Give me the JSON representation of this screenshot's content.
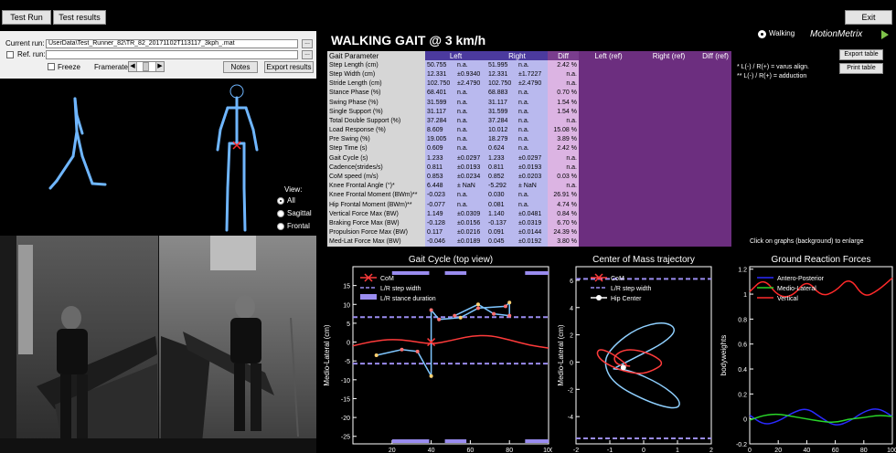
{
  "toolbar": {
    "test_run_tab": "Test Run",
    "test_results_tab": "Test results",
    "exit_button": "Exit"
  },
  "left": {
    "current_run_label": "Current run:",
    "current_run_value": "UserData\\Test_Runner_82\\TR_82_20171102T113117_3kph_.mat",
    "browse_button": "...",
    "ref_run_label": "Ref. run:",
    "ref_run_value": "",
    "freeze_label": "Freeze",
    "framerate_label": "Framerate",
    "notes_button": "Notes",
    "export_results_button": "Export results",
    "view_label": "View:",
    "view_options": [
      "All",
      "Sagittal",
      "Frontal"
    ],
    "view_selected": "All"
  },
  "header": {
    "title": "WALKING GAIT @ 3  km/h",
    "mode_label": "Walking",
    "brand": "MotionMetrix"
  },
  "table": {
    "columns": [
      "Gait Parameter",
      "Left",
      "Right",
      "Diff",
      "Left (ref)",
      "Right (ref)",
      "Diff (ref)"
    ],
    "rows": [
      {
        "name": "Step Length (cm)",
        "left": "50.755",
        "left_sd": "n.a.",
        "right": "51.995",
        "right_sd": "n.a.",
        "diff": "2.42 %"
      },
      {
        "name": "Step Width (cm)",
        "left": "12.331",
        "left_sd": "±0.9340",
        "right": "12.331",
        "right_sd": "±1.7227",
        "diff": "n.a."
      },
      {
        "name": "Stride Length (cm)",
        "left": "102.750",
        "left_sd": "±2.4790",
        "right": "102.750",
        "right_sd": "±2.4790",
        "diff": "n.a."
      },
      {
        "name": "Stance Phase (%)",
        "left": "68.401",
        "left_sd": "n.a.",
        "right": "68.883",
        "right_sd": "n.a.",
        "diff": "0.70 %"
      },
      {
        "name": "Swing Phase (%)",
        "left": "31.599",
        "left_sd": "n.a.",
        "right": "31.117",
        "right_sd": "n.a.",
        "diff": "1.54 %"
      },
      {
        "name": "Single Support (%)",
        "left": "31.117",
        "left_sd": "n.a.",
        "right": "31.599",
        "right_sd": "n.a.",
        "diff": "1.54 %"
      },
      {
        "name": "Total Double Support (%)",
        "left": "37.284",
        "left_sd": "n.a.",
        "right": "37.284",
        "right_sd": "n.a.",
        "diff": "n.a."
      },
      {
        "name": "Load Response (%)",
        "left": "8.609",
        "left_sd": "n.a.",
        "right": "10.012",
        "right_sd": "n.a.",
        "diff": "15.08 %"
      },
      {
        "name": "Pre Swing (%)",
        "left": "19.005",
        "left_sd": "n.a.",
        "right": "18.279",
        "right_sd": "n.a.",
        "diff": "3.89 %"
      },
      {
        "name": "Step Time (s)",
        "left": "0.609",
        "left_sd": "n.a.",
        "right": "0.624",
        "right_sd": "n.a.",
        "diff": "2.42 %"
      },
      {
        "name": "Gait Cycle (s)",
        "left": "1.233",
        "left_sd": "±0.0297",
        "right": "1.233",
        "right_sd": "±0.0297",
        "diff": "n.a."
      },
      {
        "name": "Cadence(strides/s)",
        "left": "0.811",
        "left_sd": "±0.0193",
        "right": "0.811",
        "right_sd": "±0.0193",
        "diff": "n.a."
      },
      {
        "name": "CoM speed (m/s)",
        "left": "0.853",
        "left_sd": "±0.0234",
        "right": "0.852",
        "right_sd": "±0.0203",
        "diff": "0.03 %"
      },
      {
        "name": "Knee Frontal Angle (°)*",
        "left": "6.448",
        "left_sd": "±  NaN",
        "right": "-5.292",
        "right_sd": "±  NaN",
        "diff": "n.a."
      },
      {
        "name": "Knee Frontal Moment (BWm)**",
        "left": "-0.023",
        "left_sd": "n.a.",
        "right": "0.030",
        "right_sd": "n.a.",
        "diff": "26.91 %"
      },
      {
        "name": "Hip Frontal Moment (BWm)**",
        "left": "-0.077",
        "left_sd": "n.a.",
        "right": "0.081",
        "right_sd": "n.a.",
        "diff": "4.74 %"
      },
      {
        "name": "Vertical Force Max (BW)",
        "left": "1.149",
        "left_sd": "±0.0309",
        "right": "1.140",
        "right_sd": "±0.0481",
        "diff": "0.84 %"
      },
      {
        "name": "Braking Force Max (BW)",
        "left": "-0.128",
        "left_sd": "±0.0156",
        "right": "-0.137",
        "right_sd": "±0.0319",
        "diff": "6.70 %"
      },
      {
        "name": "Propulsion Force Max (BW)",
        "left": "0.117",
        "left_sd": "±0.0216",
        "right": "0.091",
        "right_sd": "±0.0144",
        "diff": "24.39 %"
      },
      {
        "name": "Med-Lat Force Max (BW)",
        "left": "-0.046",
        "left_sd": "±0.0189",
        "right": "0.045",
        "right_sd": "±0.0192",
        "diff": "3.80 %"
      }
    ]
  },
  "side": {
    "note1": "*  L(-) / R(+) = varus align.",
    "note2": "** L(-) / R(+) = adduction",
    "export_table_button": "Export table",
    "print_table_button": "Print table",
    "enlarge_hint": "Click on graphs (background) to enlarge"
  },
  "colors": {
    "table_name_bg": "#d6d6d6",
    "table_value_bg": "#b9b9ee",
    "table_diff_bg": "#dcb4e3",
    "table_ref_bg": "#6c2e7f",
    "com": "#ff3b3b",
    "step_width": "#9a8cf0",
    "hip_center": "#ffffff",
    "antero_posterior": "#2a2aff",
    "medio_lateral": "#29d629",
    "vertical": "#ff2a2a",
    "skeleton": "#6fb6ff"
  },
  "chart_data": [
    {
      "type": "line",
      "title": "Gait Cycle (top view)",
      "ylabel": "Medio-Lateral (cm)",
      "xlabel": "",
      "xlim": [
        0,
        100
      ],
      "ylim": [
        -27,
        20
      ],
      "yticks": [
        15,
        10,
        5,
        0,
        -5,
        -10,
        -15,
        -20,
        -25
      ],
      "xticks": [
        20,
        40,
        60,
        80,
        100
      ],
      "legend": [
        "CoM",
        "L/R step width",
        "L/R stance duration"
      ],
      "legend_position": "top-left",
      "series": [
        {
          "name": "CoM",
          "x": [
            0,
            10,
            20,
            30,
            40,
            50,
            60,
            70,
            80,
            90,
            100
          ],
          "y": [
            -1,
            0.2,
            0.8,
            0.3,
            -0.6,
            0.4,
            1.6,
            1.8,
            0.6,
            -0.8,
            -1.6
          ]
        },
        {
          "name": "L/R step width",
          "y_upper": 6.6,
          "y_lower": -5.7
        }
      ],
      "foot_polyline": {
        "x": [
          12,
          25,
          33,
          40,
          40,
          44,
          55,
          64,
          78,
          80,
          80,
          72,
          64,
          52
        ],
        "y": [
          -3.5,
          -2,
          -2.5,
          -9,
          8.5,
          6,
          6.5,
          9,
          9.5,
          10.5,
          7,
          7.5,
          10,
          7
        ]
      },
      "stance_bars_x": [
        [
          20,
          39
        ],
        [
          47,
          58
        ],
        [
          88,
          100
        ]
      ]
    },
    {
      "type": "line",
      "title": "Center of Mass trajectory",
      "ylabel": "Medio-Lateral (cm)",
      "xlabel": "",
      "xlim": [
        -2,
        2
      ],
      "ylim": [
        -6,
        7
      ],
      "yticks": [
        6,
        4,
        2,
        0,
        -2,
        -4
      ],
      "xticks": [
        -2,
        -1,
        0,
        1,
        2
      ],
      "legend": [
        "CoM",
        "L/R step width",
        "Hip Center"
      ],
      "legend_position": "top-left",
      "series": [
        {
          "name": "CoM",
          "x": [
            -0.5,
            -0.9,
            -1.3,
            -1.4,
            -1.2,
            -0.7,
            -0.1,
            0.3,
            0.6,
            0.3,
            -0.2,
            -0.6,
            -0.9,
            -0.8,
            -0.4
          ],
          "y": [
            -0.2,
            0.6,
            1.0,
            0.6,
            0,
            -0.6,
            -0.9,
            -0.6,
            -0.1,
            0.5,
            0.9,
            0.9,
            0.4,
            -0.2,
            -0.3
          ]
        },
        {
          "name": "Hip Center",
          "x": [
            -0.9,
            -0.2,
            0.6,
            1.0,
            0.6,
            -0.2,
            -0.9,
            -1.2,
            -0.9,
            0.2,
            1.0,
            1.1,
            0.5,
            -0.4,
            -0.9
          ],
          "y": [
            -0.5,
            0.4,
            1.4,
            2.4,
            3.0,
            2.5,
            1.2,
            0,
            -1.6,
            -3.0,
            -3.5,
            -2.8,
            -1.6,
            -0.6,
            -0.5
          ]
        },
        {
          "name": "L/R step width",
          "y_upper": 6.1,
          "y_lower": -5.6
        }
      ]
    },
    {
      "type": "line",
      "title": "Ground Reaction Forces",
      "ylabel": "bodyweights",
      "xlabel": "",
      "xlim": [
        0,
        100
      ],
      "ylim": [
        -0.2,
        1.22
      ],
      "yticks": [
        1.2,
        1,
        0.8,
        0.6,
        0.4,
        0.2,
        0,
        -0.2
      ],
      "xticks": [
        0,
        20,
        40,
        60,
        80,
        100
      ],
      "legend": [
        "Antero-Posterior",
        "Medio-Lateral",
        "Vertical"
      ],
      "legend_position": "top-left",
      "series": [
        {
          "name": "Antero-Posterior",
          "x": [
            0,
            10,
            20,
            30,
            40,
            50,
            60,
            70,
            80,
            90,
            100
          ],
          "y": [
            0.03,
            -0.05,
            -0.02,
            0.05,
            0.09,
            0.01,
            -0.06,
            -0.02,
            0.06,
            0.09,
            0.02
          ]
        },
        {
          "name": "Medio-Lateral",
          "x": [
            0,
            10,
            20,
            30,
            40,
            50,
            60,
            70,
            80,
            90,
            100
          ],
          "y": [
            -0.01,
            0.03,
            0.04,
            0.02,
            0,
            -0.02,
            -0.03,
            0,
            0.01,
            0.03,
            0.02
          ]
        },
        {
          "name": "Vertical",
          "x": [
            0,
            10,
            20,
            30,
            40,
            50,
            60,
            70,
            80,
            90,
            100
          ],
          "y": [
            1.02,
            1.13,
            0.98,
            0.98,
            1.12,
            0.98,
            1.02,
            1.14,
            0.97,
            1.03,
            1.13
          ]
        }
      ]
    }
  ]
}
